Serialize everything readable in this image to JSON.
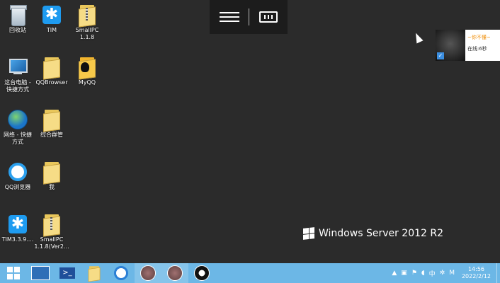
{
  "desktop": {
    "icons": [
      {
        "label": "回收站"
      },
      {
        "label": "TIM"
      },
      {
        "label": "SmallPC\n1.1.8"
      },
      {
        "label": "这台电脑 -\n快捷方式"
      },
      {
        "label": "QQBrowser"
      },
      {
        "label": "MyQQ"
      },
      {
        "label": "网络 - 快捷\n方式"
      },
      {
        "label": "综合群管"
      },
      {
        "label": "QQ浏览器"
      },
      {
        "label": "我"
      },
      {
        "label": "TIM3.3.9...."
      },
      {
        "label": "SmallPC\n1.1.8(Ver2..."
      }
    ]
  },
  "notification": {
    "name": "~你不懂~",
    "status": "在线:6秒"
  },
  "watermark": {
    "text": "Windows Server 2012 R2"
  },
  "tray": {
    "ime": "中",
    "ime_mode": "M"
  },
  "clock": {
    "time": "14:56",
    "date": "2022/2/12"
  },
  "colors": {
    "taskbar": "#6cb7e6",
    "desktop": "#2b2b2b",
    "accent": "#1e9bf0"
  }
}
